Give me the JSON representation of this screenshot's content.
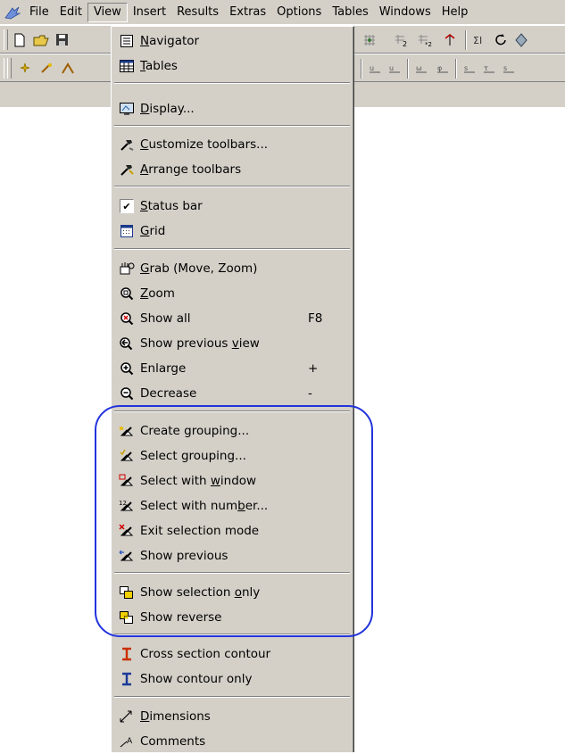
{
  "menubar": {
    "items": [
      {
        "label": "File"
      },
      {
        "label": "Edit"
      },
      {
        "label": "View"
      },
      {
        "label": "Insert"
      },
      {
        "label": "Results"
      },
      {
        "label": "Extras"
      },
      {
        "label": "Options"
      },
      {
        "label": "Tables"
      },
      {
        "label": "Windows"
      },
      {
        "label": "Help"
      }
    ]
  },
  "view_menu": {
    "items": [
      {
        "name": "menu-item-navigator",
        "icon": "navigator-icon",
        "pre": "",
        "mn": "N",
        "post": "avigator",
        "shortcut": ""
      },
      {
        "name": "menu-item-tables",
        "icon": "tables-icon",
        "pre": "",
        "mn": "T",
        "post": "ables",
        "shortcut": ""
      },
      {
        "name": "menu-item-display",
        "icon": "display-icon",
        "pre": "",
        "mn": "D",
        "post": "isplay...",
        "shortcut": ""
      },
      {
        "name": "menu-item-customize-toolbars",
        "icon": "hammer-icon",
        "pre": "",
        "mn": "C",
        "post": "ustomize toolbars...",
        "shortcut": ""
      },
      {
        "name": "menu-item-arrange-toolbars",
        "icon": "hammer-arrange-icon",
        "pre": "",
        "mn": "A",
        "post": "rrange toolbars",
        "shortcut": ""
      },
      {
        "name": "menu-item-status-bar",
        "icon": "checkmark-icon",
        "pre": "",
        "mn": "S",
        "post": "tatus bar",
        "shortcut": ""
      },
      {
        "name": "menu-item-grid",
        "icon": "grid-icon",
        "pre": "",
        "mn": "G",
        "post": "rid",
        "shortcut": ""
      },
      {
        "name": "menu-item-grab",
        "icon": "grab-icon",
        "pre": "",
        "mn": "G",
        "post": "rab (Move, Zoom)",
        "shortcut": ""
      },
      {
        "name": "menu-item-zoom",
        "icon": "zoom-icon",
        "pre": "",
        "mn": "Z",
        "post": "oom",
        "shortcut": ""
      },
      {
        "name": "menu-item-show-all",
        "icon": "show-all-icon",
        "pre": "Show all",
        "mn": "",
        "post": "",
        "shortcut": "F8"
      },
      {
        "name": "menu-item-show-previous-view",
        "icon": "previous-view-icon",
        "pre": "Show previous ",
        "mn": "v",
        "post": "iew",
        "shortcut": ""
      },
      {
        "name": "menu-item-enlarge",
        "icon": "enlarge-icon",
        "pre": "Enlarge",
        "mn": "",
        "post": "",
        "shortcut": "+"
      },
      {
        "name": "menu-item-decrease",
        "icon": "decrease-icon",
        "pre": "Decrease",
        "mn": "",
        "post": "",
        "shortcut": "-"
      },
      {
        "name": "menu-item-create-grouping",
        "icon": "create-grouping-icon",
        "pre": "Create grouping...",
        "mn": "",
        "post": "",
        "shortcut": ""
      },
      {
        "name": "menu-item-select-grouping",
        "icon": "select-grouping-icon",
        "pre": "Select grouping...",
        "mn": "",
        "post": "",
        "shortcut": ""
      },
      {
        "name": "menu-item-select-with-window",
        "icon": "select-window-icon",
        "pre": "Select with ",
        "mn": "w",
        "post": "indow",
        "shortcut": ""
      },
      {
        "name": "menu-item-select-with-number",
        "icon": "select-number-icon",
        "pre": "Select with num",
        "mn": "b",
        "post": "er...",
        "shortcut": ""
      },
      {
        "name": "menu-item-exit-selection-mode",
        "icon": "exit-selection-icon",
        "pre": "Exit selection mode",
        "mn": "",
        "post": "",
        "shortcut": ""
      },
      {
        "name": "menu-item-show-previous",
        "icon": "show-previous-icon",
        "pre": "Show previous",
        "mn": "",
        "post": "",
        "shortcut": ""
      },
      {
        "name": "menu-item-show-selection-only",
        "icon": "selection-only-icon",
        "pre": "Show selection ",
        "mn": "o",
        "post": "nly",
        "shortcut": ""
      },
      {
        "name": "menu-item-show-reverse",
        "icon": "show-reverse-icon",
        "pre": "Show reverse",
        "mn": "",
        "post": "",
        "shortcut": ""
      },
      {
        "name": "menu-item-cross-section-contour",
        "icon": "cross-section-icon",
        "pre": "Cross section contour",
        "mn": "",
        "post": "",
        "shortcut": ""
      },
      {
        "name": "menu-item-show-contour-only",
        "icon": "contour-only-icon",
        "pre": "Show contour only",
        "mn": "",
        "post": "",
        "shortcut": ""
      },
      {
        "name": "menu-item-dimensions",
        "icon": "dimensions-icon",
        "pre": "",
        "mn": "D",
        "post": "imensions",
        "shortcut": ""
      },
      {
        "name": "menu-item-comments",
        "icon": "comments-icon",
        "pre": "Comments",
        "mn": "",
        "post": "",
        "shortcut": ""
      }
    ]
  },
  "colors": {
    "menu_bg": "#d4d0c8",
    "highlight_outline": "#2233dd"
  }
}
